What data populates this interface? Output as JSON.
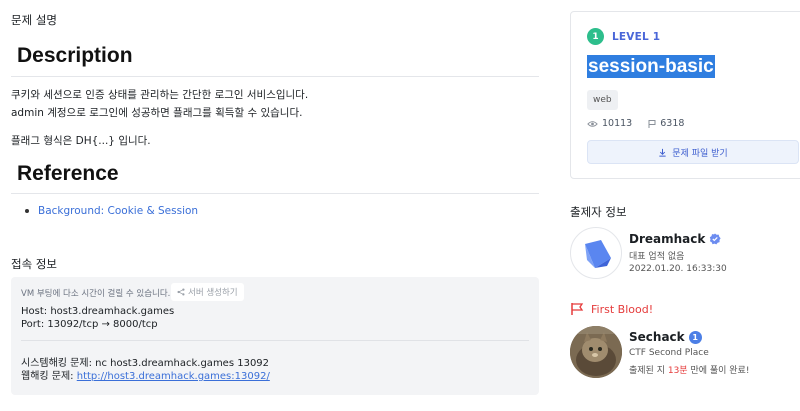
{
  "description_section": {
    "title": "문제 설명",
    "heading": "Description",
    "line1": "쿠키와 세션으로 인증 상태를 관리하는 간단한 로그인 서비스입니다.",
    "line2": "admin 계정으로 로그인에 성공하면 플래그를 획득할 수 있습니다.",
    "line3": "플래그 형식은 DH{...} 입니다."
  },
  "reference_section": {
    "heading": "Reference",
    "links": [
      "Background: Cookie & Session"
    ]
  },
  "access_section": {
    "title": "접속 정보",
    "vm_note": "VM 부팅에 다소 시간이 걸릴 수 있습니다.",
    "generate_label": "서버 생성하기",
    "host": "Host: host3.dreamhack.games",
    "port": "Port:  13092/tcp → 8000/tcp",
    "system_label": "시스템해킹 문제: nc host3.dreamhack.games 13092",
    "web_label": "웹해킹 문제: ",
    "web_url": "http://host3.dreamhack.games:13092/"
  },
  "challenge": {
    "level_number": "1",
    "level_text": "LEVEL 1",
    "title": "session-basic",
    "tag": "web",
    "views": "10113",
    "solves": "6318",
    "download_label": "문제 파일 받기"
  },
  "author": {
    "section_title": "출제자 정보",
    "name": "Dreamhack",
    "subtitle": "대표 업적 없음",
    "date": "2022.01.20. 16:33:30"
  },
  "first_blood": {
    "label": "First Blood!",
    "name": "Sechack",
    "badge": "1",
    "subtitle": "CTF Second Place",
    "solve_prefix": "출제된 지 ",
    "solve_time": "13분",
    "solve_suffix": " 만에 풀이 완료!"
  },
  "colors": {
    "accent": "#4a66d8",
    "level_green": "#2dbe8c",
    "link": "#3a6fd8",
    "first_blood_red": "#e53b3b"
  },
  "icons": [
    "eye-icon",
    "flag-icon",
    "download-icon",
    "share-icon",
    "verified-icon",
    "first-blood-flag-icon"
  ]
}
